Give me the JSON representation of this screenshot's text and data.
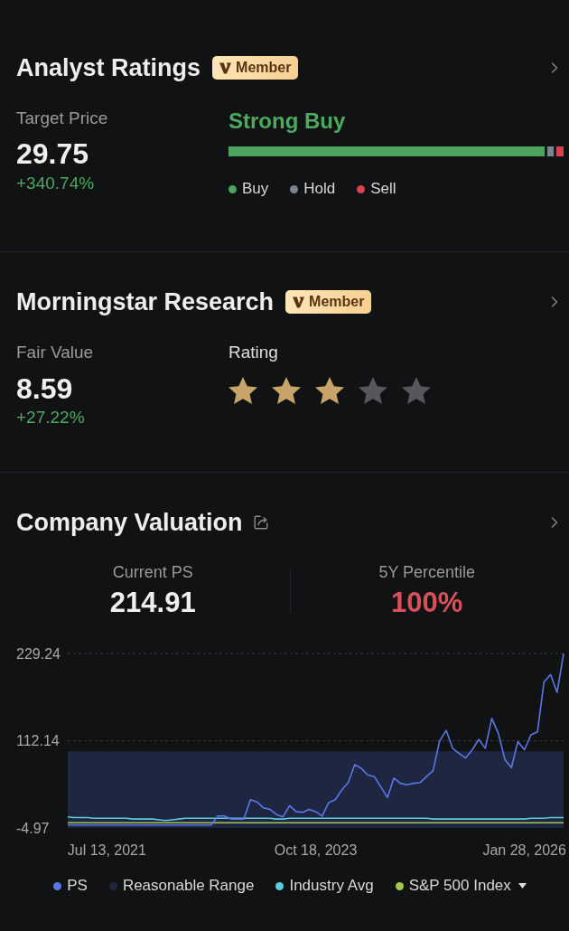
{
  "analyst_ratings": {
    "title": "Analyst Ratings",
    "badge": "Member",
    "target_label": "Target Price",
    "target_value": "29.75",
    "target_change": "+340.74%",
    "positive": true,
    "consensus": "Strong Buy",
    "ratings": [
      {
        "label": "Buy",
        "color": "#4ea35f",
        "level": 0.943
      },
      {
        "label": "Hold",
        "color": "#7d8592"
      },
      {
        "label": "Sell",
        "color": "#d8414d",
        "level": 0.022
      }
    ]
  },
  "morningstar": {
    "title": "Morningstar Research",
    "badge": "Member",
    "fair_value_label": "Fair Value",
    "fair_value": "8.59",
    "fair_value_change": "+27.22%",
    "positive": true,
    "rating_label": "Rating",
    "stars": 3
  },
  "valuation": {
    "title": "Company Valuation",
    "metrics": [
      {
        "label": "Current PS",
        "value": "214.91",
        "kind": "plain"
      },
      {
        "label": "5Y Percentile",
        "value": "100%",
        "kind": "alert"
      }
    ],
    "benchmark_dropdown": true,
    "chart_data": {
      "type": "line",
      "categories": [
        null,
        null,
        null,
        null,
        null,
        null,
        "Jul 13, 2021",
        null,
        null,
        null,
        null,
        null,
        null,
        null,
        null,
        null,
        null,
        null,
        null,
        null,
        null,
        null,
        null,
        null,
        null,
        null,
        null,
        null,
        null,
        null,
        null,
        null,
        null,
        null,
        null,
        null,
        null,
        null,
        "Oct 18, 2023",
        null,
        null,
        null,
        null,
        null,
        null,
        null,
        null,
        null,
        null,
        null,
        null,
        null,
        null,
        null,
        null,
        null,
        null,
        null,
        null,
        null,
        null,
        null,
        null,
        null,
        null,
        null,
        null,
        null,
        null,
        null,
        "Jan 28, 2026",
        null,
        null,
        null,
        null,
        null,
        null
      ],
      "ylim": [
        -4.97,
        229.24
      ],
      "yticks": [
        -4.97,
        112.14,
        229.24
      ],
      "series": [
        {
          "name": "PS",
          "color": "#5b78e8",
          "values": [
            -1,
            -1,
            -1,
            -1,
            -1,
            -1,
            -1,
            -1,
            -1,
            -1,
            -1,
            -1,
            -1,
            -1,
            -1,
            -1,
            -1,
            -1,
            -1,
            -1,
            -1,
            -1,
            -1,
            11,
            11,
            7,
            7,
            7,
            33,
            30,
            22,
            20,
            13,
            10,
            25,
            17,
            16,
            20,
            17,
            11,
            29,
            33,
            46,
            56,
            80,
            75,
            66,
            64,
            50,
            36,
            62,
            55,
            53,
            55,
            56,
            64,
            72,
            112,
            126,
            102,
            95,
            89,
            100,
            114,
            102,
            142,
            122,
            87,
            76,
            111,
            100,
            120,
            124,
            191,
            201,
            177,
            229
          ]
        },
        {
          "name": "Industry Avg",
          "color": "#5ccbdb",
          "values": [
            10,
            9,
            9,
            9,
            8,
            8,
            8,
            8,
            8,
            8,
            7,
            7,
            7,
            7,
            6,
            5,
            6,
            7,
            8,
            8,
            8,
            8,
            8,
            8,
            8,
            8,
            8,
            8,
            8,
            8,
            8,
            8,
            7,
            7,
            8,
            8,
            8,
            8,
            8,
            8,
            8,
            8,
            8,
            8,
            8,
            8,
            8,
            8,
            8,
            8,
            8,
            8,
            8,
            8,
            8,
            8,
            7,
            7,
            7,
            7,
            7,
            7,
            7,
            7,
            7,
            7,
            7,
            7,
            7,
            7,
            7,
            8,
            8,
            8,
            9,
            9,
            9
          ]
        },
        {
          "name": "S&P 500 Index",
          "color": "#a4c64c",
          "values": [
            2,
            2,
            2,
            2,
            2,
            2,
            2,
            2,
            2,
            2,
            2,
            2,
            2,
            2,
            2,
            2,
            2,
            2,
            2,
            2,
            2,
            2,
            2,
            2,
            2,
            2,
            2,
            2,
            2,
            2,
            2,
            2,
            2,
            2,
            2,
            2,
            2,
            2,
            2,
            2,
            2,
            2,
            2,
            2,
            2,
            2,
            2,
            2,
            2,
            2,
            2,
            2,
            2,
            2,
            2,
            2,
            2,
            2,
            2,
            2,
            2,
            2,
            2,
            2,
            2,
            2,
            2,
            2,
            2,
            2,
            2,
            2,
            2,
            2,
            2,
            2,
            2
          ]
        }
      ],
      "bands": [
        {
          "label": "Reasonable Range",
          "color": "#1e2642",
          "axis": "y",
          "from": -4.97,
          "to": 98
        }
      ]
    }
  }
}
